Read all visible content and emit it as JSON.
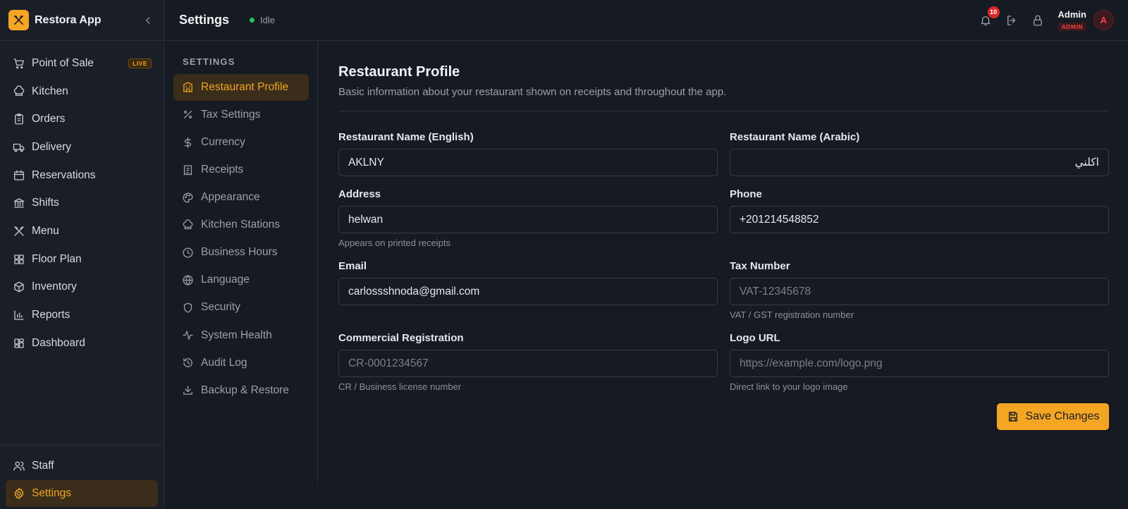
{
  "app": {
    "name": "Restora App"
  },
  "sidebar": {
    "items": [
      {
        "label": "Point of Sale",
        "icon": "cart-icon",
        "badge": "LIVE"
      },
      {
        "label": "Kitchen",
        "icon": "chef-hat-icon"
      },
      {
        "label": "Orders",
        "icon": "clipboard-icon"
      },
      {
        "label": "Delivery",
        "icon": "truck-icon"
      },
      {
        "label": "Reservations",
        "icon": "calendar-icon"
      },
      {
        "label": "Shifts",
        "icon": "bank-icon"
      },
      {
        "label": "Menu",
        "icon": "utensils-icon"
      },
      {
        "label": "Floor Plan",
        "icon": "grid-icon"
      },
      {
        "label": "Inventory",
        "icon": "package-icon"
      },
      {
        "label": "Reports",
        "icon": "bar-chart-icon"
      },
      {
        "label": "Dashboard",
        "icon": "layout-icon"
      }
    ],
    "bottom_items": [
      {
        "label": "Staff",
        "icon": "users-icon"
      },
      {
        "label": "Settings",
        "icon": "gear-icon",
        "active": true
      }
    ]
  },
  "topbar": {
    "title": "Settings",
    "status": "Idle",
    "notifications_count": "10",
    "user_name": "Admin",
    "user_role": "ADMIN",
    "avatar_initial": "A"
  },
  "settings_nav": {
    "header": "SETTINGS",
    "items": [
      {
        "label": "Restaurant Profile",
        "icon": "building-icon",
        "active": true
      },
      {
        "label": "Tax Settings",
        "icon": "percent-icon"
      },
      {
        "label": "Currency",
        "icon": "dollar-icon"
      },
      {
        "label": "Receipts",
        "icon": "receipt-icon"
      },
      {
        "label": "Appearance",
        "icon": "palette-icon"
      },
      {
        "label": "Kitchen Stations",
        "icon": "chef-hat-icon"
      },
      {
        "label": "Business Hours",
        "icon": "clock-icon"
      },
      {
        "label": "Language",
        "icon": "globe-icon"
      },
      {
        "label": "Security",
        "icon": "shield-icon"
      },
      {
        "label": "System Health",
        "icon": "activity-icon"
      },
      {
        "label": "Audit Log",
        "icon": "history-icon"
      },
      {
        "label": "Backup & Restore",
        "icon": "download-icon"
      }
    ]
  },
  "profile": {
    "title": "Restaurant Profile",
    "subtitle": "Basic information about your restaurant shown on receipts and throughout the app.",
    "fields": {
      "name_en": {
        "label": "Restaurant Name (English)",
        "value": "AKLNY"
      },
      "name_ar": {
        "label": "Restaurant Name (Arabic)",
        "value": "اكلني"
      },
      "address": {
        "label": "Address",
        "value": "helwan",
        "hint": "Appears on printed receipts"
      },
      "phone": {
        "label": "Phone",
        "value": "+201214548852"
      },
      "email": {
        "label": "Email",
        "value": "carlossshnoda@gmail.com"
      },
      "tax_number": {
        "label": "Tax Number",
        "value": "",
        "placeholder": "VAT-12345678",
        "hint": "VAT / GST registration number"
      },
      "commercial_reg": {
        "label": "Commercial Registration",
        "value": "",
        "placeholder": "CR-0001234567",
        "hint": "CR / Business license number"
      },
      "logo_url": {
        "label": "Logo URL",
        "value": "",
        "placeholder": "https://example.com/logo.png",
        "hint": "Direct link to your logo image"
      }
    },
    "save_label": "Save Changes"
  },
  "colors": {
    "accent": "#f5a524",
    "background": "#161a22",
    "status_ok": "#22c55e",
    "danger": "#ef4444"
  }
}
